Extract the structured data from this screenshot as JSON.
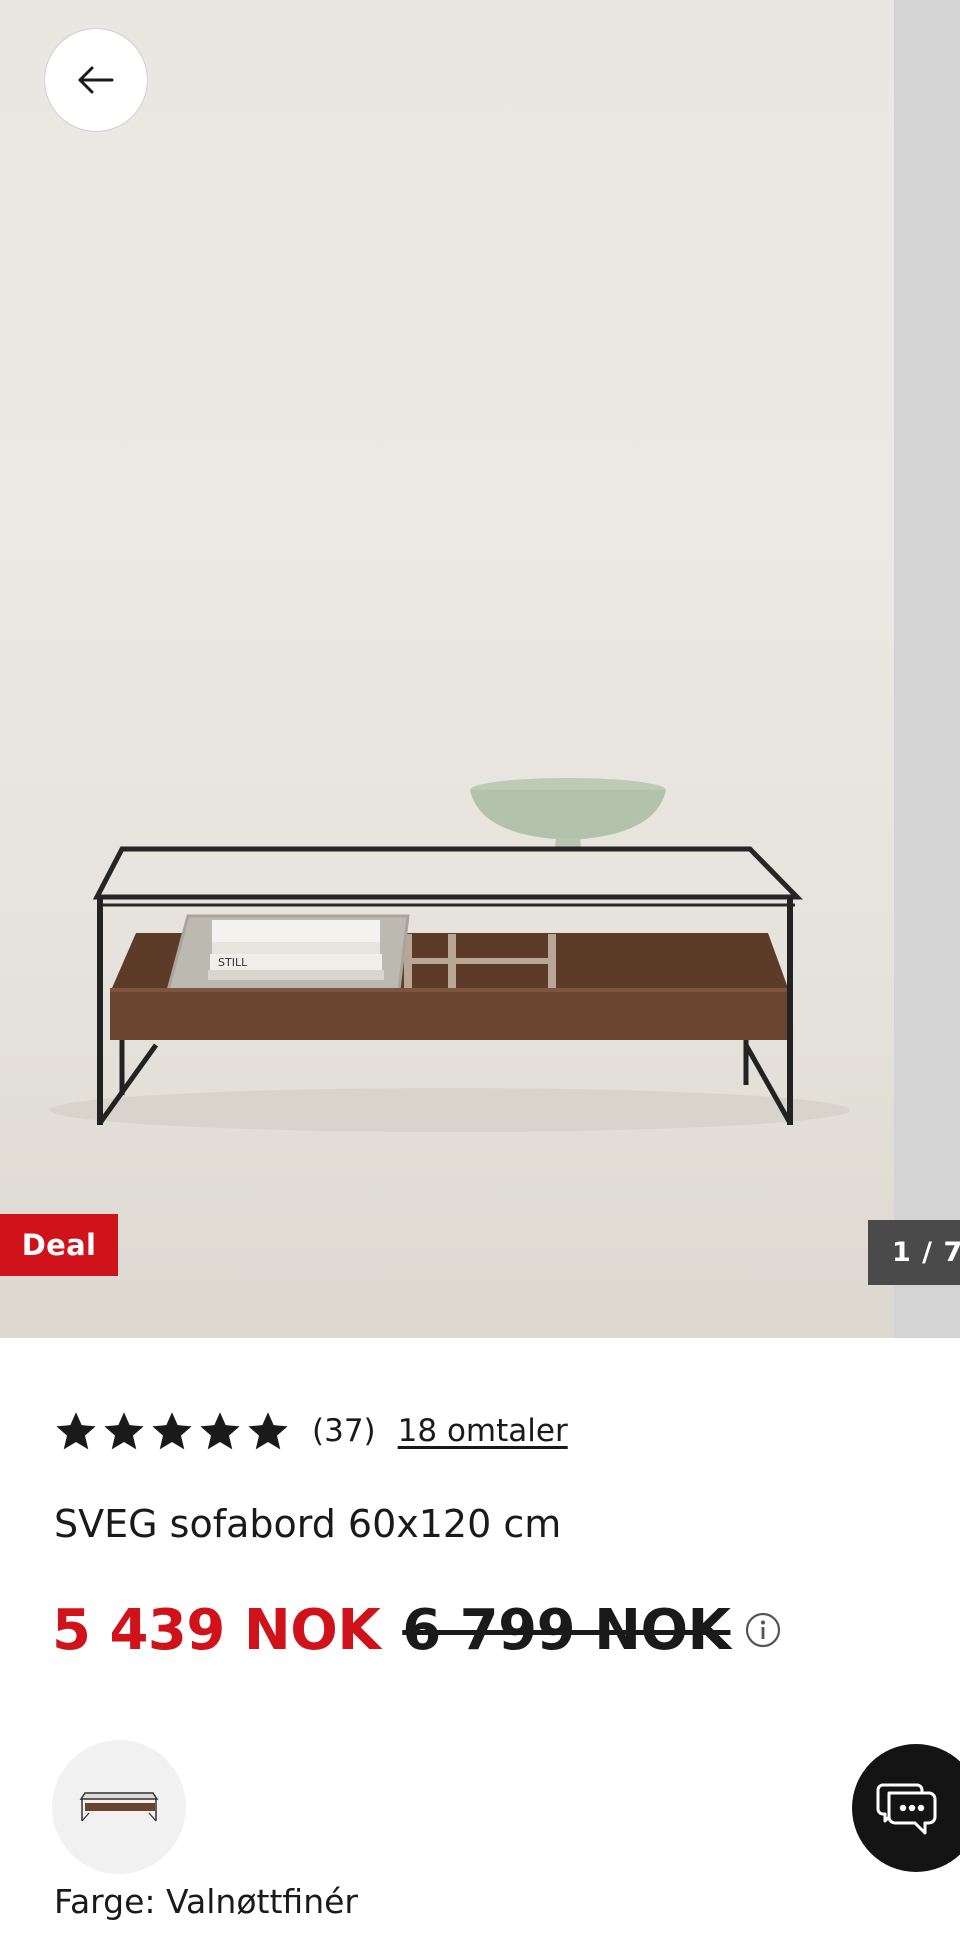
{
  "gallery": {
    "badge": "Deal",
    "counter": "1 / 7",
    "image_alt": "SVEG sofabord 60x120 cm",
    "book_spine_text": "STILL"
  },
  "back_button": {
    "icon": "arrow-left-icon"
  },
  "rating": {
    "stars": 5,
    "count": "(37)",
    "reviews_link": "18 omtaler"
  },
  "product": {
    "title": "SVEG sofabord 60x120 cm"
  },
  "price": {
    "current": "5 439 NOK",
    "original": "6 799 NOK",
    "info_icon": "info-icon"
  },
  "variant": {
    "color_label": "Farge: Valnøttfinér"
  },
  "chat": {
    "icon": "chat-bubbles-icon"
  },
  "colors": {
    "sale_red": "#d0121b",
    "text": "#1a1a1a",
    "counter_bg": "#4a4a4a",
    "chat_bg": "#141414"
  }
}
